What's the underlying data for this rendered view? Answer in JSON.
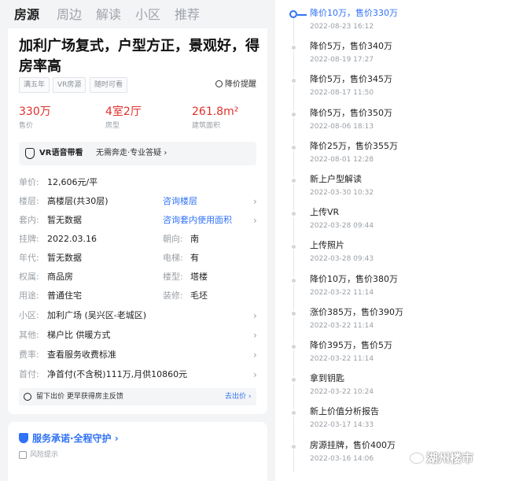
{
  "tabs": [
    "房源",
    "周边",
    "解读",
    "小区",
    "推荐"
  ],
  "listing": {
    "title": "加利广场复式，户型方正，景观好，得房率高",
    "tags": [
      "满五年",
      "VR房源",
      "随时可看"
    ],
    "price_alert": "降价提醒",
    "stats": [
      {
        "value": "330万",
        "label": "售价"
      },
      {
        "value": "4室2厅",
        "label": "房型"
      },
      {
        "value": "261.8m²",
        "label": "建筑面积"
      }
    ],
    "vr": {
      "title": "VR语音带看",
      "subtitle": "无需奔走·专业答疑 ›"
    },
    "details": {
      "unit_price": {
        "label": "单价:",
        "value": "12,606元/平"
      },
      "floor": {
        "label": "楼层:",
        "value": "高楼层(共30层)",
        "link": "咨询楼层"
      },
      "inner": {
        "label": "套内:",
        "value": "暂无数据",
        "link": "咨询套内使用面积"
      },
      "listed": {
        "label": "挂牌:",
        "value": "2022.03.16",
        "label2": "朝向:",
        "value2": "南"
      },
      "year": {
        "label": "年代:",
        "value": "暂无数据",
        "label2": "电梯:",
        "value2": "有"
      },
      "ownership": {
        "label": "权属:",
        "value": "商品房",
        "label2": "楼型:",
        "value2": "塔楼"
      },
      "usage": {
        "label": "用途:",
        "value": "普通住宅",
        "label2": "装修:",
        "value2": "毛坯"
      },
      "community": {
        "label": "小区:",
        "value": "加利广场 (吴兴区-老城区)"
      },
      "other": {
        "label": "其他:",
        "value": "梯户比 供暖方式"
      },
      "fees": {
        "label": "费率:",
        "value": "查看服务收费标准"
      },
      "down_payment": {
        "label": "首付:",
        "value": "净首付(不含税)111万,月供10860元"
      }
    },
    "feedback": {
      "text": "留下出价 更早获得房主反馈",
      "button": "去出价 ›"
    },
    "service": {
      "text": "服务承诺·全程守护 ›",
      "risk": "风险提示"
    }
  },
  "timeline": [
    {
      "text": "降价10万，售价330万",
      "date": "2022-08-23 16:12",
      "active": true
    },
    {
      "text": "降价5万，售价340万",
      "date": "2022-08-19 17:27"
    },
    {
      "text": "降价5万，售价345万",
      "date": "2022-08-17 11:50"
    },
    {
      "text": "降价5万，售价350万",
      "date": "2022-08-06 18:13"
    },
    {
      "text": "降价25万，售价355万",
      "date": "2022-08-01 12:28"
    },
    {
      "text": "新上户型解读",
      "date": "2022-03-30 10:32"
    },
    {
      "text": "上传VR",
      "date": "2022-03-28 09:44"
    },
    {
      "text": "上传照片",
      "date": "2022-03-28 09:43"
    },
    {
      "text": "降价10万，售价380万",
      "date": "2022-03-22 11:14"
    },
    {
      "text": "涨价385万，售价390万",
      "date": "2022-03-22 11:14"
    },
    {
      "text": "降价395万，售价5万",
      "date": "2022-03-22 11:14"
    },
    {
      "text": "拿到钥匙",
      "date": "2022-03-22 10:24"
    },
    {
      "text": "新上价值分析报告",
      "date": "2022-03-17 14:33"
    },
    {
      "text": "房源挂牌，售价400万",
      "date": "2022-03-16 14:06"
    }
  ],
  "watermark": "湖州楼市",
  "colors": {
    "accent": "#3072f6",
    "price_red": "#e0302b"
  }
}
